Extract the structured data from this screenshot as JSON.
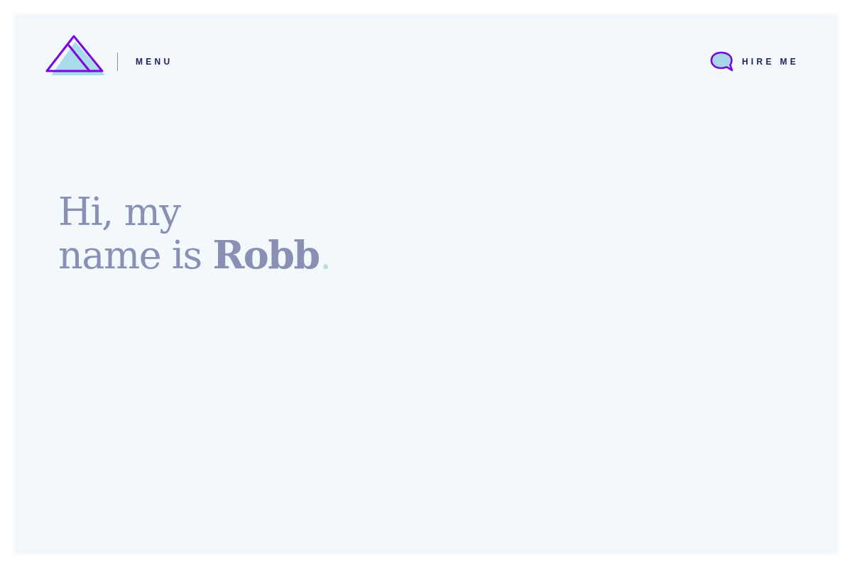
{
  "header": {
    "menu_label": "MENU",
    "hire_label": "HIRE ME"
  },
  "hero": {
    "line_1": "Hi, my",
    "line_2": "name is **Robb**",
    "end_mark": "."
  }
}
